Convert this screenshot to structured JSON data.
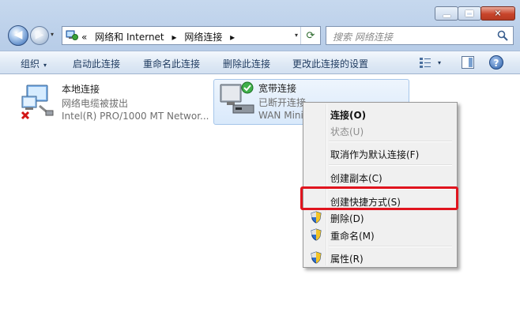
{
  "window": {
    "minimize_glyph": "",
    "maximize_glyph": "",
    "close_glyph": "✕"
  },
  "nav": {
    "back_glyph": "◀",
    "forward_glyph": "▶",
    "recent_drop": "▾"
  },
  "address": {
    "overflow": "«",
    "crumb1": "网络和 Internet",
    "crumb2": "网络连接",
    "sep": "▸",
    "drop": "▾",
    "refresh_glyph": "⟳"
  },
  "search": {
    "placeholder": "搜索 网络连接"
  },
  "toolbar": {
    "organize": "组织",
    "enable": "启动此连接",
    "rename": "重命名此连接",
    "delete": "删除此连接",
    "change_settings": "更改此连接的设置",
    "drop": "▾",
    "help": "?"
  },
  "connections": [
    {
      "name": "本地连接",
      "status": "网络电缆被拔出",
      "device": "Intel(R) PRO/1000 MT Networ..."
    },
    {
      "name": "宽带连接",
      "status": "已断开连接",
      "device": "WAN Mini"
    }
  ],
  "context_menu": {
    "connect": "连接(O)",
    "status": "状态(U)",
    "cancel_default": "取消作为默认连接(F)",
    "create_copy": "创建副本(C)",
    "create_shortcut": "创建快捷方式(S)",
    "delete": "删除(D)",
    "rename": "重命名(M)",
    "properties": "属性(R)"
  },
  "colors": {
    "highlight_border": "#e0141e",
    "frame": "#b8cde8",
    "selection": "#d9e9fb"
  }
}
